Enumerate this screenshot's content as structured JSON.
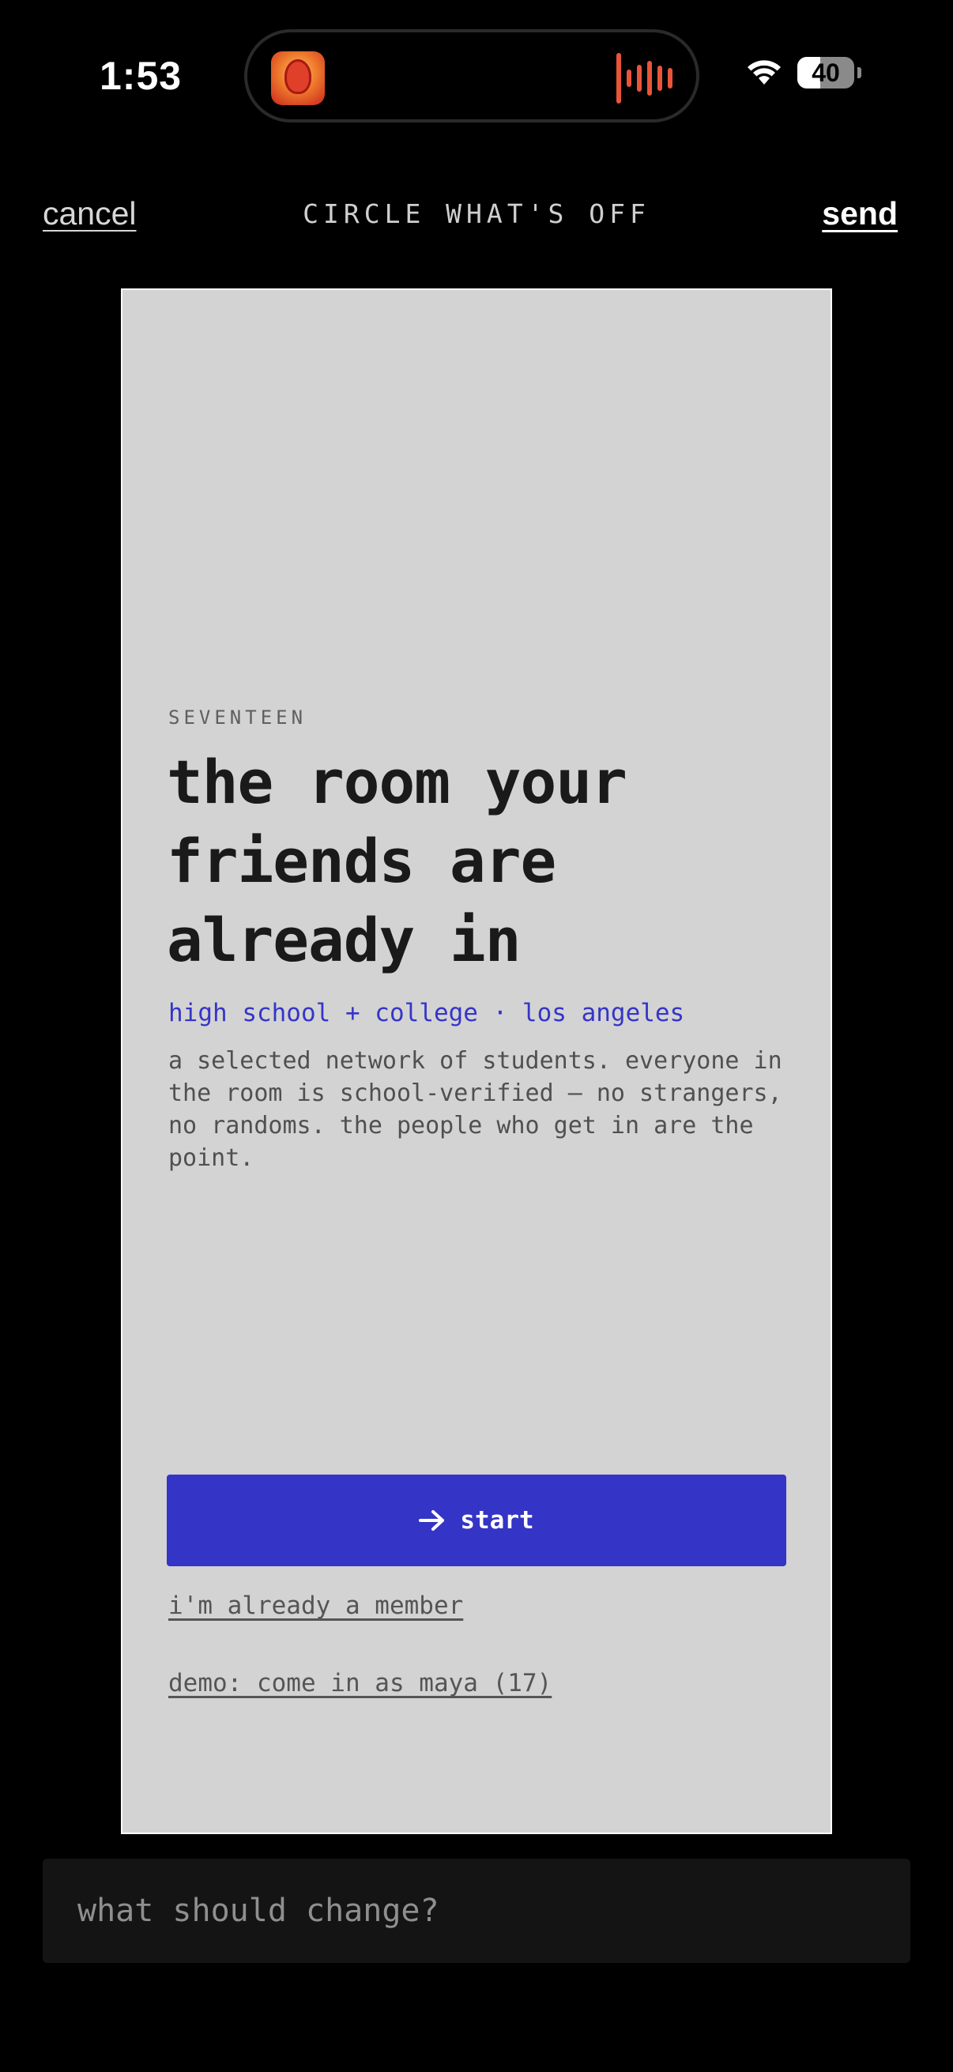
{
  "status_bar": {
    "time": "1:53",
    "battery_level": "40",
    "battery_fraction": 0.4,
    "now_playing_icon": "album-art-icon",
    "waveform_icon": "audio-waveform-icon",
    "wifi_icon": "wifi-icon"
  },
  "nav": {
    "cancel_label": "cancel",
    "title": "CIRCLE WHAT'S OFF",
    "send_label": "send"
  },
  "card": {
    "eyebrow": "SEVENTEEN",
    "headline": "the room your friends are already in",
    "tagline": "high school + college · los angeles",
    "description": "a selected network of students. everyone in the room is school-verified — no strangers, no randoms. the people who get in are the point.",
    "start_label": "start",
    "start_icon": "arrow-right-icon",
    "member_link": "i'm already a member",
    "demo_link": "demo: come in as maya (17)"
  },
  "feedback": {
    "placeholder": "what should change?",
    "value": ""
  },
  "colors": {
    "accent": "#3434c6",
    "card_background": "#d3d3d3",
    "page_background": "#000000",
    "island_accent": "#e9553a"
  }
}
